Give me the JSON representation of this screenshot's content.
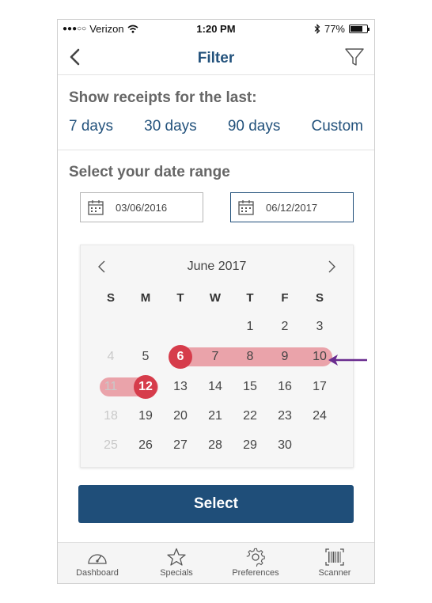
{
  "status_bar": {
    "carrier": "Verizon",
    "time": "1:20 PM",
    "battery": "77%",
    "battery_level": 0.77
  },
  "nav": {
    "title": "Filter",
    "back_icon": "chevron-left-icon",
    "filter_icon": "funnel-icon"
  },
  "receipts": {
    "label": "Show receipts for the last:",
    "options": [
      "7 days",
      "30 days",
      "90 days",
      "Custom"
    ]
  },
  "date_range": {
    "label": "Select your date range",
    "start": "03/06/2016",
    "end": "06/12/2017"
  },
  "calendar": {
    "month": "June 2017",
    "weekdays": [
      "S",
      "M",
      "T",
      "W",
      "T",
      "F",
      "S"
    ],
    "weeks": [
      [
        "",
        "",
        "",
        "",
        "1",
        "2",
        "3"
      ],
      [
        "4",
        "5",
        "6",
        "7",
        "8",
        "9",
        "10"
      ],
      [
        "11",
        "12",
        "13",
        "14",
        "15",
        "16",
        "17"
      ],
      [
        "18",
        "19",
        "20",
        "21",
        "22",
        "23",
        "24"
      ],
      [
        "25",
        "26",
        "27",
        "28",
        "29",
        "30",
        ""
      ]
    ],
    "selected_start": "6",
    "selected_end": "12"
  },
  "select_button": "Select",
  "tabs": [
    {
      "label": "Dashboard",
      "icon": "speedometer-icon"
    },
    {
      "label": "Specials",
      "icon": "star-icon"
    },
    {
      "label": "Preferences",
      "icon": "gear-icon"
    },
    {
      "label": "Scanner",
      "icon": "barcode-icon"
    }
  ],
  "colors": {
    "brand": "#1f4e79",
    "link": "#23527c",
    "selected": "#d63c4b",
    "range": "#eaa3aa",
    "annotation": "#6a2c8f"
  }
}
